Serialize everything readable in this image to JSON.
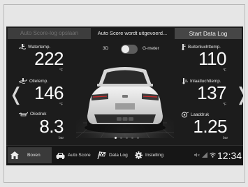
{
  "topbar": {
    "autoscore_log_save": "Auto Score-log opslaan",
    "autoscore_status": "Auto Score wordt uitgevoerd...",
    "start_data_log": "Start Data Log"
  },
  "toggle": {
    "left_label": "3D",
    "right_label": "G-meter"
  },
  "gauges": {
    "water_temp": {
      "label": "Watertemp.",
      "value": "222",
      "unit": "°F",
      "icon": "coolant-temp-icon"
    },
    "oil_temp": {
      "label": "Olietemp.",
      "value": "146",
      "unit": "°F",
      "icon": "oil-temp-icon"
    },
    "oil_pressure": {
      "label": "Oliedruk",
      "value": "8.3",
      "unit": "bar",
      "icon": "oil-pressure-icon"
    },
    "outside_temp": {
      "label": "Buitenluchttemp.",
      "value": "110",
      "unit": "°F",
      "icon": "outside-temp-icon"
    },
    "intake_temp": {
      "label": "Inlaatluchttemp.",
      "value": "137",
      "unit": "°F",
      "icon": "intake-temp-icon"
    },
    "boost": {
      "label": "Laaddruk",
      "value": "1.25",
      "unit": "bar",
      "icon": "turbo-icon"
    }
  },
  "page_indicator": {
    "count": 5,
    "active": 1
  },
  "nav": {
    "home": "Boven",
    "auto_score": "Auto Score",
    "data_log": "Data Log",
    "settings": "Instelling"
  },
  "status": {
    "time": "12:34"
  }
}
